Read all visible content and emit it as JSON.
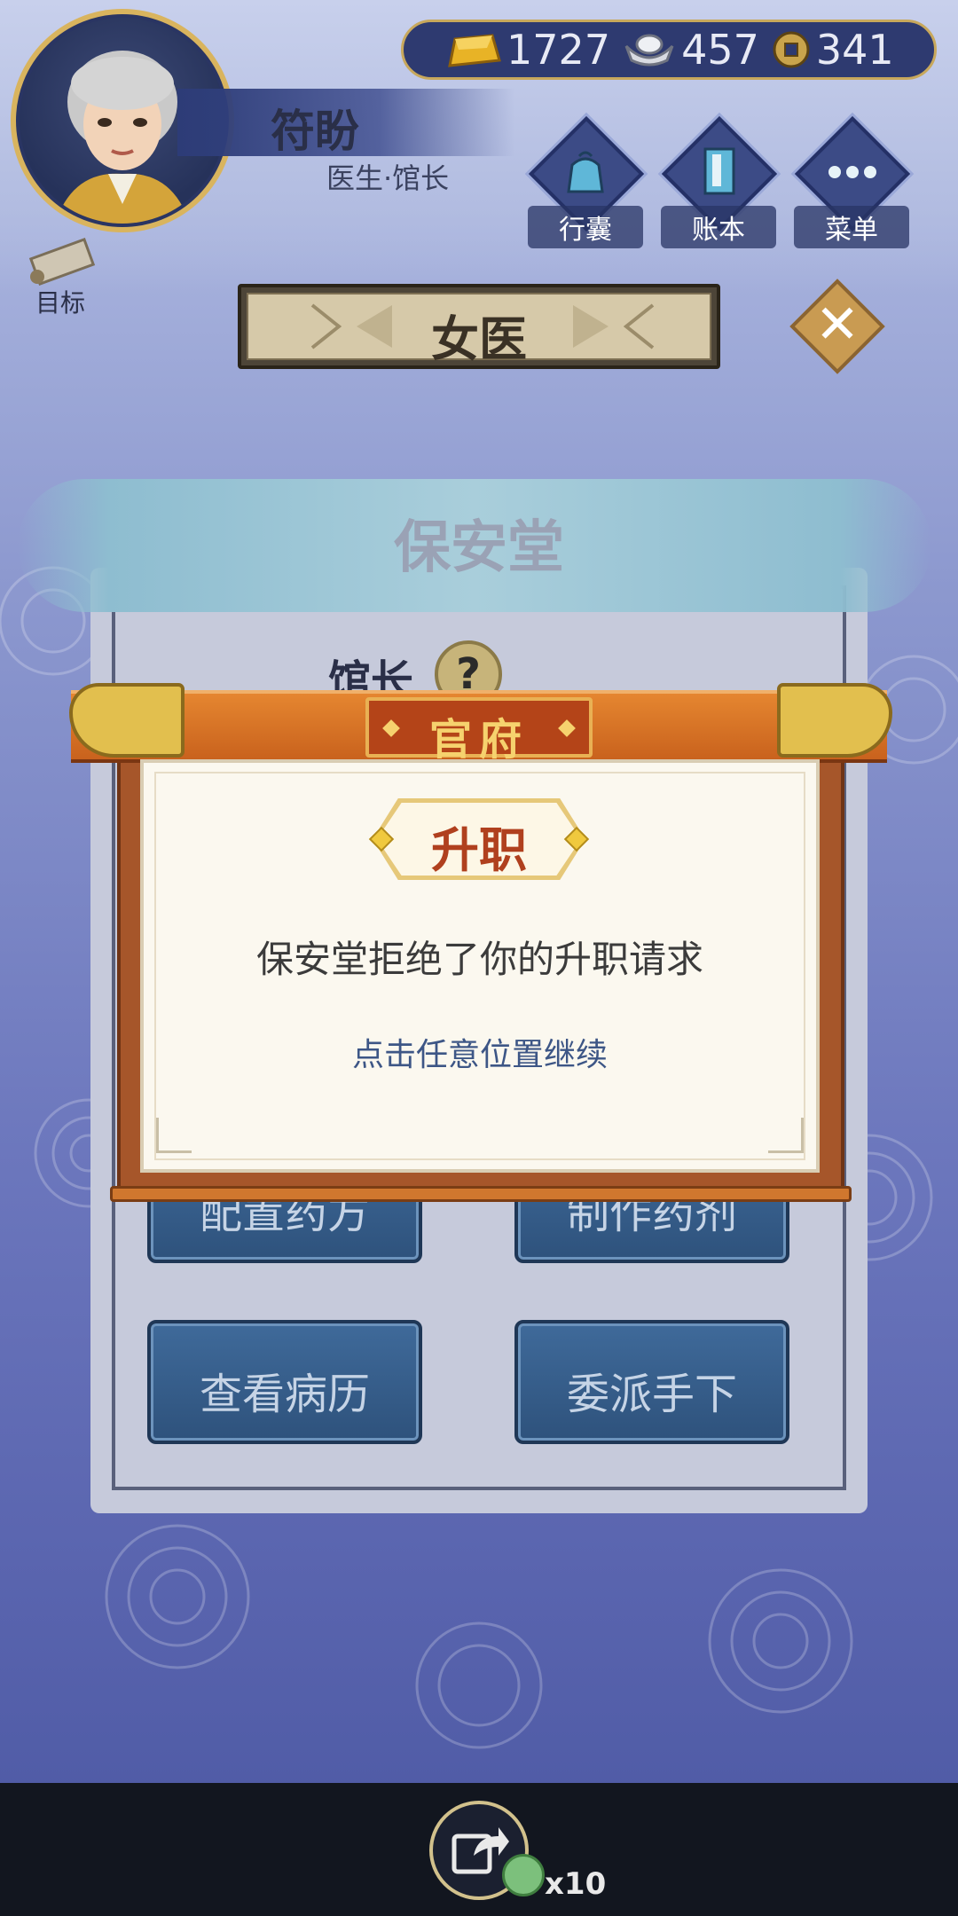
{
  "player": {
    "name": "符盼",
    "title": "医生·馆长"
  },
  "currency": {
    "gold": "1727",
    "silver": "457",
    "coins": "341"
  },
  "menu": {
    "bag": "行囊",
    "ledger": "账本",
    "menu": "菜单",
    "goal": "目标"
  },
  "header": {
    "title": "女医"
  },
  "hall": {
    "name": "保安堂",
    "role_label": "馆长",
    "help": "?"
  },
  "actions": {
    "prepare_prescription": "配置药方",
    "make_medicine": "制作药剂",
    "view_records": "查看病历",
    "assign_staff": "委派手下"
  },
  "modal": {
    "header": "官府",
    "badge": "升职",
    "message": "保安堂拒绝了你的升职请求",
    "hint": "点击任意位置继续"
  },
  "share": {
    "count": "x10"
  },
  "colors": {
    "modal_header": "#d9712a",
    "modal_badge_text": "#b0401e",
    "hint_text": "#3d5686",
    "action_button": "#3f6a9a"
  },
  "icons": [
    "gold-bar-icon",
    "silver-ingot-icon",
    "copper-coin-icon",
    "bag-icon",
    "ledger-icon",
    "menu-dots-icon",
    "scroll-icon",
    "close-icon",
    "help-icon",
    "share-icon"
  ]
}
